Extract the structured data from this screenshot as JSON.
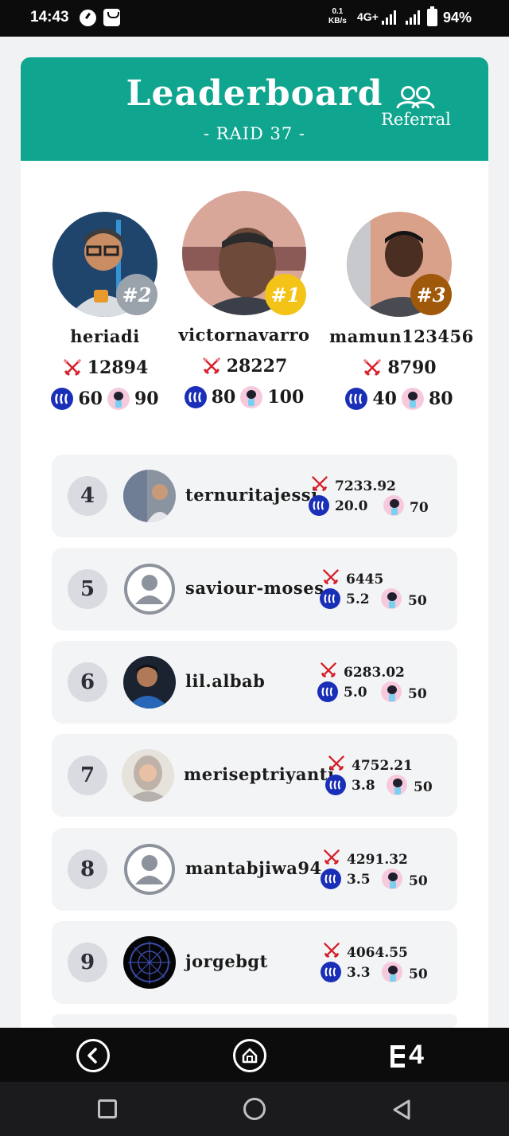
{
  "status_bar": {
    "time": "14:43",
    "speed_value": "0.1",
    "speed_unit": "KB/s",
    "network": "4G+",
    "battery": "94%"
  },
  "header": {
    "title": "Leaderboard",
    "subtitle": "- RAID 37 -",
    "referral_label": "Referral",
    "background_color": "#0fa58f"
  },
  "podium": [
    {
      "rank_badge": "#2",
      "name": "heriadi",
      "score": "12894",
      "steem": "60",
      "fan": "90",
      "badge_color": "#9aa2ac"
    },
    {
      "rank_badge": "#1",
      "name": "victornavarro",
      "score": "28227",
      "steem": "80",
      "fan": "100",
      "badge_color": "#f3c317"
    },
    {
      "rank_badge": "#3",
      "name": "mamun123456",
      "score": "8790",
      "steem": "40",
      "fan": "80",
      "badge_color": "#a0580a"
    }
  ],
  "leaderboard": [
    {
      "rank": "4",
      "name": "ternuritajessi",
      "score": "7233.92",
      "steem": "20.0",
      "fan": "70"
    },
    {
      "rank": "5",
      "name": "saviour-moses",
      "score": "6445",
      "steem": "5.2",
      "fan": "50"
    },
    {
      "rank": "6",
      "name": "lil.albab",
      "score": "6283.02",
      "steem": "5.0",
      "fan": "50"
    },
    {
      "rank": "7",
      "name": "meriseptriyanti",
      "score": "4752.21",
      "steem": "3.8",
      "fan": "50"
    },
    {
      "rank": "8",
      "name": "mantabjiwa94",
      "score": "4291.32",
      "steem": "3.5",
      "fan": "50"
    },
    {
      "rank": "9",
      "name": "jorgebgt",
      "score": "4064.55",
      "steem": "3.3",
      "fan": "50"
    }
  ],
  "bottom_nav": {
    "items": [
      "back-icon",
      "home-icon",
      "leaderboard-logo-icon"
    ],
    "logo_text": "4"
  },
  "system_nav": {
    "items": [
      "recents-icon",
      "home-circle-icon",
      "back-triangle-icon"
    ]
  }
}
